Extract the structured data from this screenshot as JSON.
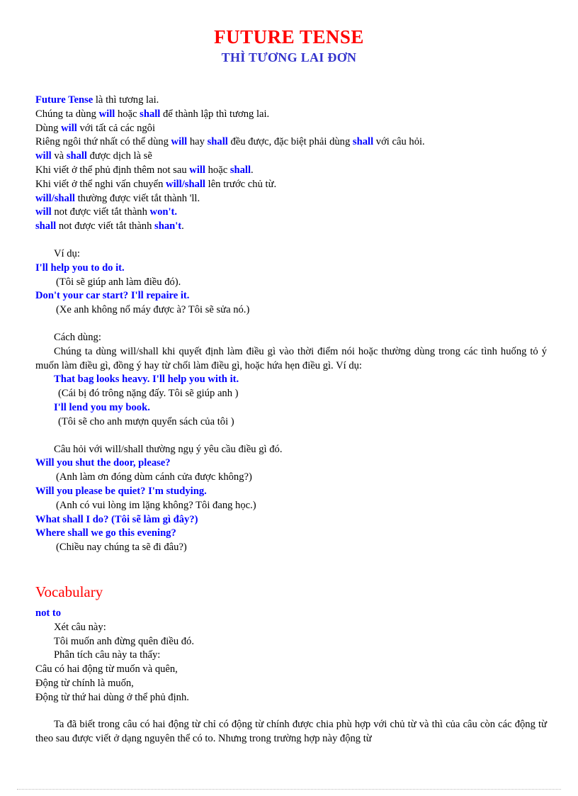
{
  "document": {
    "title": "FUTURE TENSE",
    "subtitle": "THÌ TƯƠNG LAI ĐƠN",
    "title_color": "#ff0000",
    "subtitle_color": "#3333cc",
    "keyword_color": "#0000ff",
    "heading_color": "#ff0000"
  },
  "intro": {
    "l1_a": "Future Tense",
    "l1_b": " là thì tương lai.",
    "l2_a": "Chúng ta dùng ",
    "l2_b": "will",
    "l2_c": " hoặc ",
    "l2_d": "shall",
    "l2_e": " để thành lập thì tương lai.",
    "l3_a": "Dùng ",
    "l3_b": "will",
    "l3_c": " với tất cả các ngôi",
    "l4_a": "Riêng ngôi thứ nhất có thể dùng ",
    "l4_b": "will",
    "l4_c": " hay ",
    "l4_d": "shall",
    "l4_e": " đều được, đặc biệt phải dùng ",
    "l4_f": "shall",
    "l4_g": " với câu hỏi.",
    "l5_a": "will",
    "l5_b": " và ",
    "l5_c": "shall",
    "l5_d": " được dịch là sẽ",
    "l6_a": "Khi viết ở thể phủ định thêm not sau ",
    "l6_b": "will",
    "l6_c": " hoặc ",
    "l6_d": "shall",
    "l6_e": ".",
    "l7_a": "Khi viết ở thể nghi vấn chuyển ",
    "l7_b": "will/shall",
    "l7_c": " lên trước chủ từ.",
    "l8_a": "will/shall",
    "l8_b": " thường được viết tắt thành 'll.",
    "l9_a": "will",
    "l9_b": " not được viết tắt thành ",
    "l9_c": "won't.",
    "l10_a": "shall",
    "l10_b": " not được viết tắt thành ",
    "l10_c": "shan't",
    "l10_d": "."
  },
  "examples_1": {
    "label": "Ví dụ:",
    "e1_en": "I'll help you to do it.",
    "e1_vi": "(Tôi sẽ giúp anh làm điều đó).",
    "e2_en": "Don't your car start? I'll repaire it.",
    "e2_vi": "(Xe anh không nổ máy được à? Tôi sẽ sửa nó.)"
  },
  "usage": {
    "label": "Cách dùng:",
    "paragraph": "Chúng ta dùng will/shall khi quyết định làm điều gì vào thời điểm nói hoặc thường dùng trong các tình huống tỏ ý muốn làm điều gì, đồng ý hay từ chối làm điều gì, hoặc hứa hẹn điều gì. Ví dụ:",
    "e1_en": "That bag looks heavy. I'll help you with it.",
    "e1_vi": "(Cái bị đó trông nặng đấy. Tôi sẽ giúp anh )",
    "e2_en": "I'll lend you my book.",
    "e2_vi": "(Tôi sẽ cho anh mượn quyển sách của tôi )"
  },
  "questions": {
    "intro": "Câu hỏi với will/shall thường ngụ ý yêu cầu điều gì đó.",
    "q1_en": "Will you shut the door, please?",
    "q1_vi": "(Anh làm ơn đóng dùm cánh cửa được không?)",
    "q2_en": "Will you please be quiet? I'm studying.",
    "q2_vi": "(Anh có vui lòng im lặng không? Tôi đang học.)",
    "q3_en": "What shall I do? (Tôi sẽ làm gì đây?)",
    "q4_en": "Where shall we go this evening?",
    "q4_vi": "(Chiều nay chúng ta sẽ đi đâu?)"
  },
  "vocabulary": {
    "heading": "Vocabulary",
    "entry": "not to",
    "l1": "Xét câu này:",
    "l2": "Tôi muốn anh đừng quên điều đó.",
    "l3": "Phân tích câu này ta thấy:",
    "l4": "Câu có hai động từ muốn và quên,",
    "l5": "Động từ chính là muốn,",
    "l6": "Động từ thứ hai dùng ở thể phủ định.",
    "closing_paragraph": "Ta đã biết trong câu có hai động từ chỉ có động từ chính được chia phù hợp với chủ từ và thì của câu còn các động từ theo sau được viết ở dạng nguyên thể có to. Nhưng trong trường hợp này động từ"
  }
}
